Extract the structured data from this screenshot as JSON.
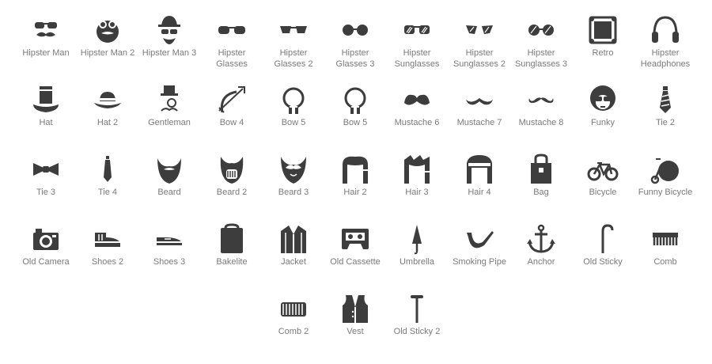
{
  "colors": {
    "icon": "#3d3d3d",
    "label": "#7a7a7a",
    "background": "#ffffff"
  },
  "icons": [
    {
      "label": "Hipster Man",
      "icon": "hipster-man"
    },
    {
      "label": "Hipster Man 2",
      "icon": "hipster-man-2"
    },
    {
      "label": "Hipster Man 3",
      "icon": "hipster-man-3"
    },
    {
      "label": "Hipster Glasses",
      "icon": "hipster-glasses"
    },
    {
      "label": "Hipster Glasses 2",
      "icon": "hipster-glasses-2"
    },
    {
      "label": "Hipster Glasses 3",
      "icon": "hipster-glasses-3"
    },
    {
      "label": "Hipster Sunglasses",
      "icon": "hipster-sunglasses"
    },
    {
      "label": "Hipster Sunglasses 2",
      "icon": "hipster-sunglasses-2"
    },
    {
      "label": "Hipster Sunglasses 3",
      "icon": "hipster-sunglasses-3"
    },
    {
      "label": "Retro",
      "icon": "retro"
    },
    {
      "label": "Hipster Headphones",
      "icon": "headphones"
    },
    {
      "label": "Hat",
      "icon": "hat"
    },
    {
      "label": "Hat 2",
      "icon": "hat-2"
    },
    {
      "label": "Gentleman",
      "icon": "gentleman"
    },
    {
      "label": "Bow 4",
      "icon": "bow-4"
    },
    {
      "label": "Bow 5",
      "icon": "bow-5"
    },
    {
      "label": "Bow 5",
      "icon": "bow-5b"
    },
    {
      "label": "Mustache 6",
      "icon": "mustache-6"
    },
    {
      "label": "Mustache 7",
      "icon": "mustache-7"
    },
    {
      "label": "Mustache 8",
      "icon": "mustache-8"
    },
    {
      "label": "Funky",
      "icon": "funky"
    },
    {
      "label": "Tie 2",
      "icon": "tie-2"
    },
    {
      "label": "Tie 3",
      "icon": "tie-3"
    },
    {
      "label": "Tie 4",
      "icon": "tie-4"
    },
    {
      "label": "Beard",
      "icon": "beard"
    },
    {
      "label": "Beard 2",
      "icon": "beard-2"
    },
    {
      "label": "Beard 3",
      "icon": "beard-3"
    },
    {
      "label": "Hair 2",
      "icon": "hair-2"
    },
    {
      "label": "Hair 3",
      "icon": "hair-3"
    },
    {
      "label": "Hair 4",
      "icon": "hair-4"
    },
    {
      "label": "Bag",
      "icon": "bag"
    },
    {
      "label": "Bicycle",
      "icon": "bicycle"
    },
    {
      "label": "Funny Bicycle",
      "icon": "funny-bicycle"
    },
    {
      "label": "Old Camera",
      "icon": "old-camera"
    },
    {
      "label": "Shoes 2",
      "icon": "shoes-2"
    },
    {
      "label": "Shoes 3",
      "icon": "shoes-3"
    },
    {
      "label": "Bakelite",
      "icon": "bakelite"
    },
    {
      "label": "Jacket",
      "icon": "jacket"
    },
    {
      "label": "Old Cassette",
      "icon": "old-cassette"
    },
    {
      "label": "Umbrella",
      "icon": "umbrella"
    },
    {
      "label": "Smoking Pipe",
      "icon": "smoking-pipe"
    },
    {
      "label": "Anchor",
      "icon": "anchor"
    },
    {
      "label": "Old Sticky",
      "icon": "old-sticky"
    },
    {
      "label": "Comb",
      "icon": "comb"
    },
    {
      "label": "Comb 2",
      "icon": "comb-2"
    },
    {
      "label": "Vest",
      "icon": "vest"
    },
    {
      "label": "Old Sticky 2",
      "icon": "old-sticky-2"
    }
  ]
}
